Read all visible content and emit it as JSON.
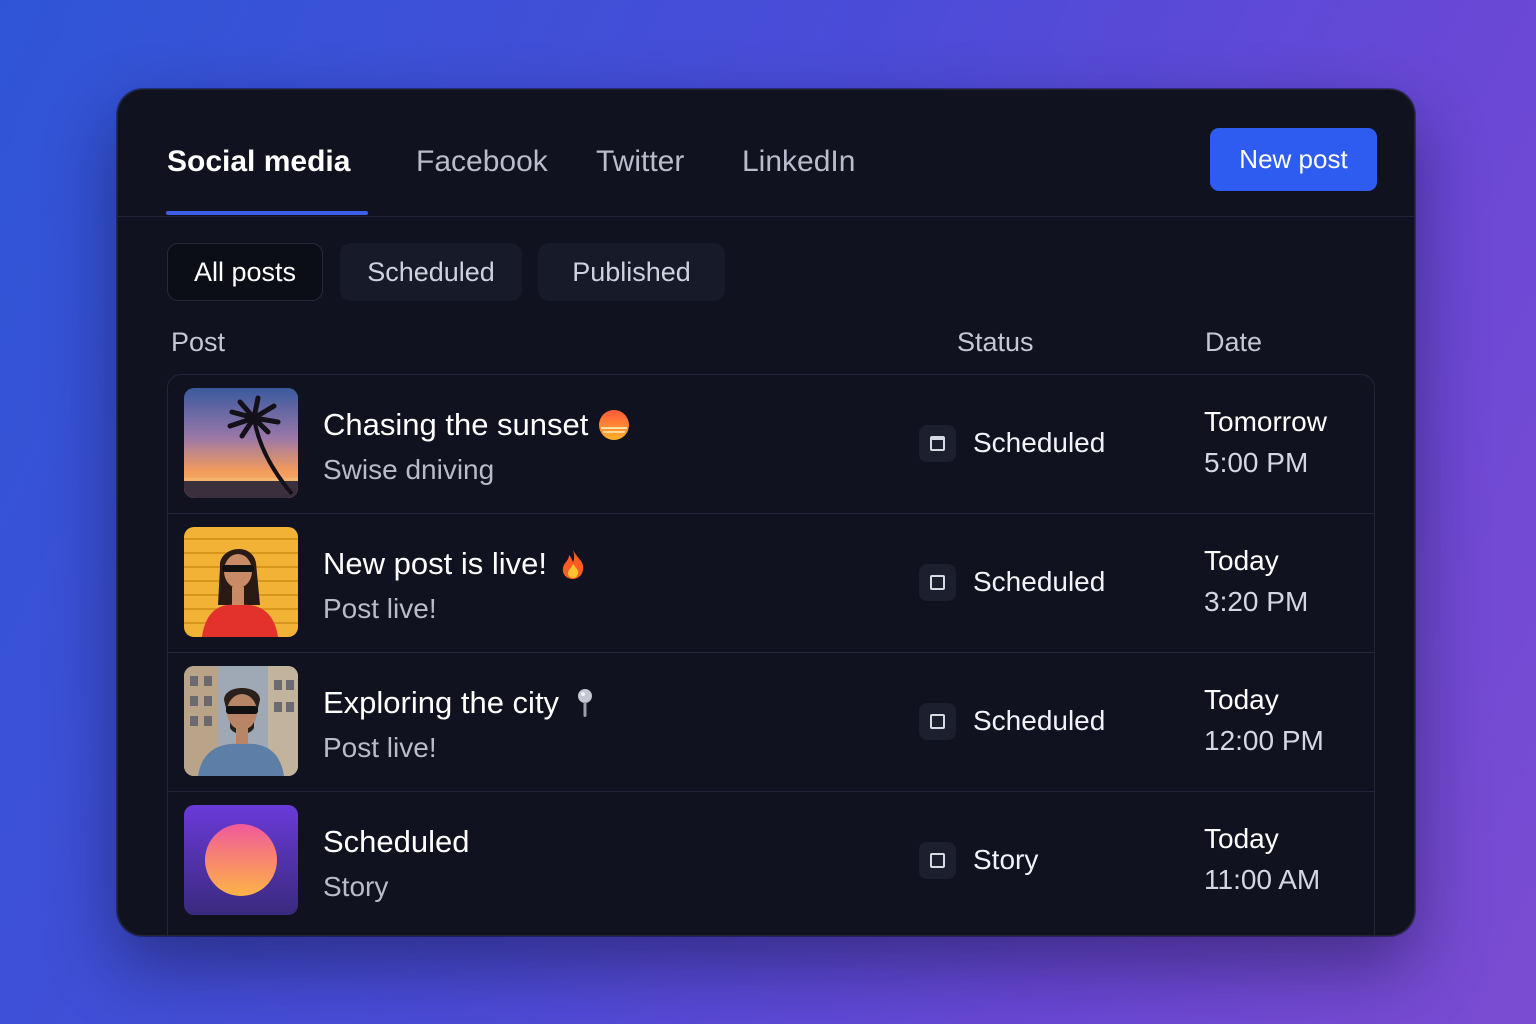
{
  "tabs": {
    "items": [
      "Social media",
      "Facebook",
      "Twitter",
      "LinkedIn"
    ],
    "active": "Social media"
  },
  "toolbar": {
    "new_post_label": "New post"
  },
  "filters": {
    "items": [
      "All posts",
      "Scheduled",
      "Published"
    ],
    "active": "All posts"
  },
  "columns": {
    "post": "Post",
    "status": "Status",
    "date": "Date"
  },
  "posts": [
    {
      "title": "Chasing the sunset",
      "emoji": "sunset-emoji",
      "subtitle": "Swise dniving",
      "status": "Scheduled",
      "status_icon": "calendar-icon",
      "day": "Tomorrow",
      "time": "5:00 PM",
      "thumbnail": "palm-tree-sunset-photo"
    },
    {
      "title": "New post is live!",
      "emoji": "fire-emoji",
      "subtitle": "Post live!",
      "status": "Scheduled",
      "status_icon": "square-icon",
      "day": "Today",
      "time": "3:20 PM",
      "thumbnail": "woman-sunglasses-photo"
    },
    {
      "title": "Exploring the city",
      "emoji": "pushpin-emoji",
      "subtitle": "Post live!",
      "status": "Scheduled",
      "status_icon": "square-icon",
      "day": "Today",
      "time": "12:00 PM",
      "thumbnail": "man-city-photo"
    },
    {
      "title": "Scheduled",
      "emoji": "",
      "subtitle": "Story",
      "status": "Story",
      "status_icon": "square-icon",
      "day": "Today",
      "time": "11:00 AM",
      "thumbnail": "gradient-circle-graphic"
    }
  ],
  "colors": {
    "accent": "#2f5cf0",
    "panel": "#10121f",
    "background_start": "#2f55d6",
    "background_end": "#7b4cd2"
  }
}
